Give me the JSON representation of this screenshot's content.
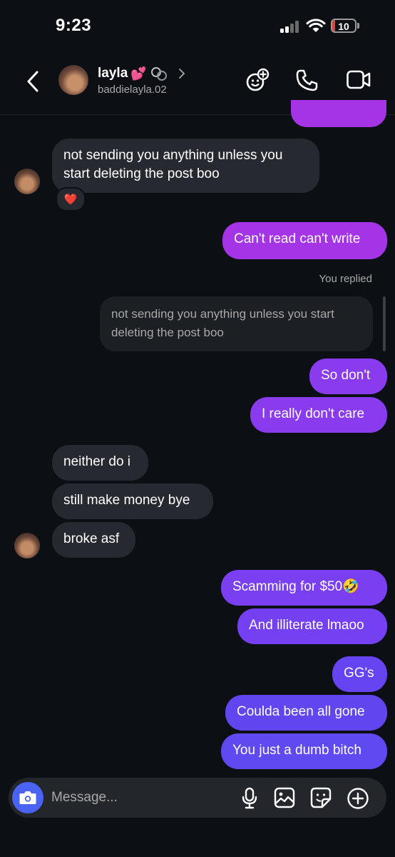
{
  "status_bar": {
    "time": "9:23",
    "battery": "10"
  },
  "header": {
    "username": "layla",
    "username_emoji": "💕",
    "handle": "baddielayla.02"
  },
  "messages": {
    "m1": "not sending you anything unless you start deleting the post boo",
    "m1_reaction": "❤️",
    "m2": "Can't read can't write",
    "replied_label": "You replied",
    "quoted": "not sending you anything unless you start deleting the post boo",
    "m3": "So don't",
    "m4": "I really don't care",
    "m5": "neither do i",
    "m6": "still make money bye",
    "m7": "broke asf",
    "m8": "Scamming for $50🤣",
    "m9": "And illiterate lmaoo",
    "m10": "GG's",
    "m11": "Coulda been all gone",
    "m12": "You just a dumb bitch"
  },
  "composer": {
    "placeholder": "Message..."
  },
  "colors": {
    "background": "#0c1014",
    "received_bubble": "#262a30",
    "sent_magenta": "#a534e6",
    "sent_violet": "#7b3ff2",
    "sent_indigo": "#5f49f0",
    "camera_button": "#4b63f2"
  }
}
